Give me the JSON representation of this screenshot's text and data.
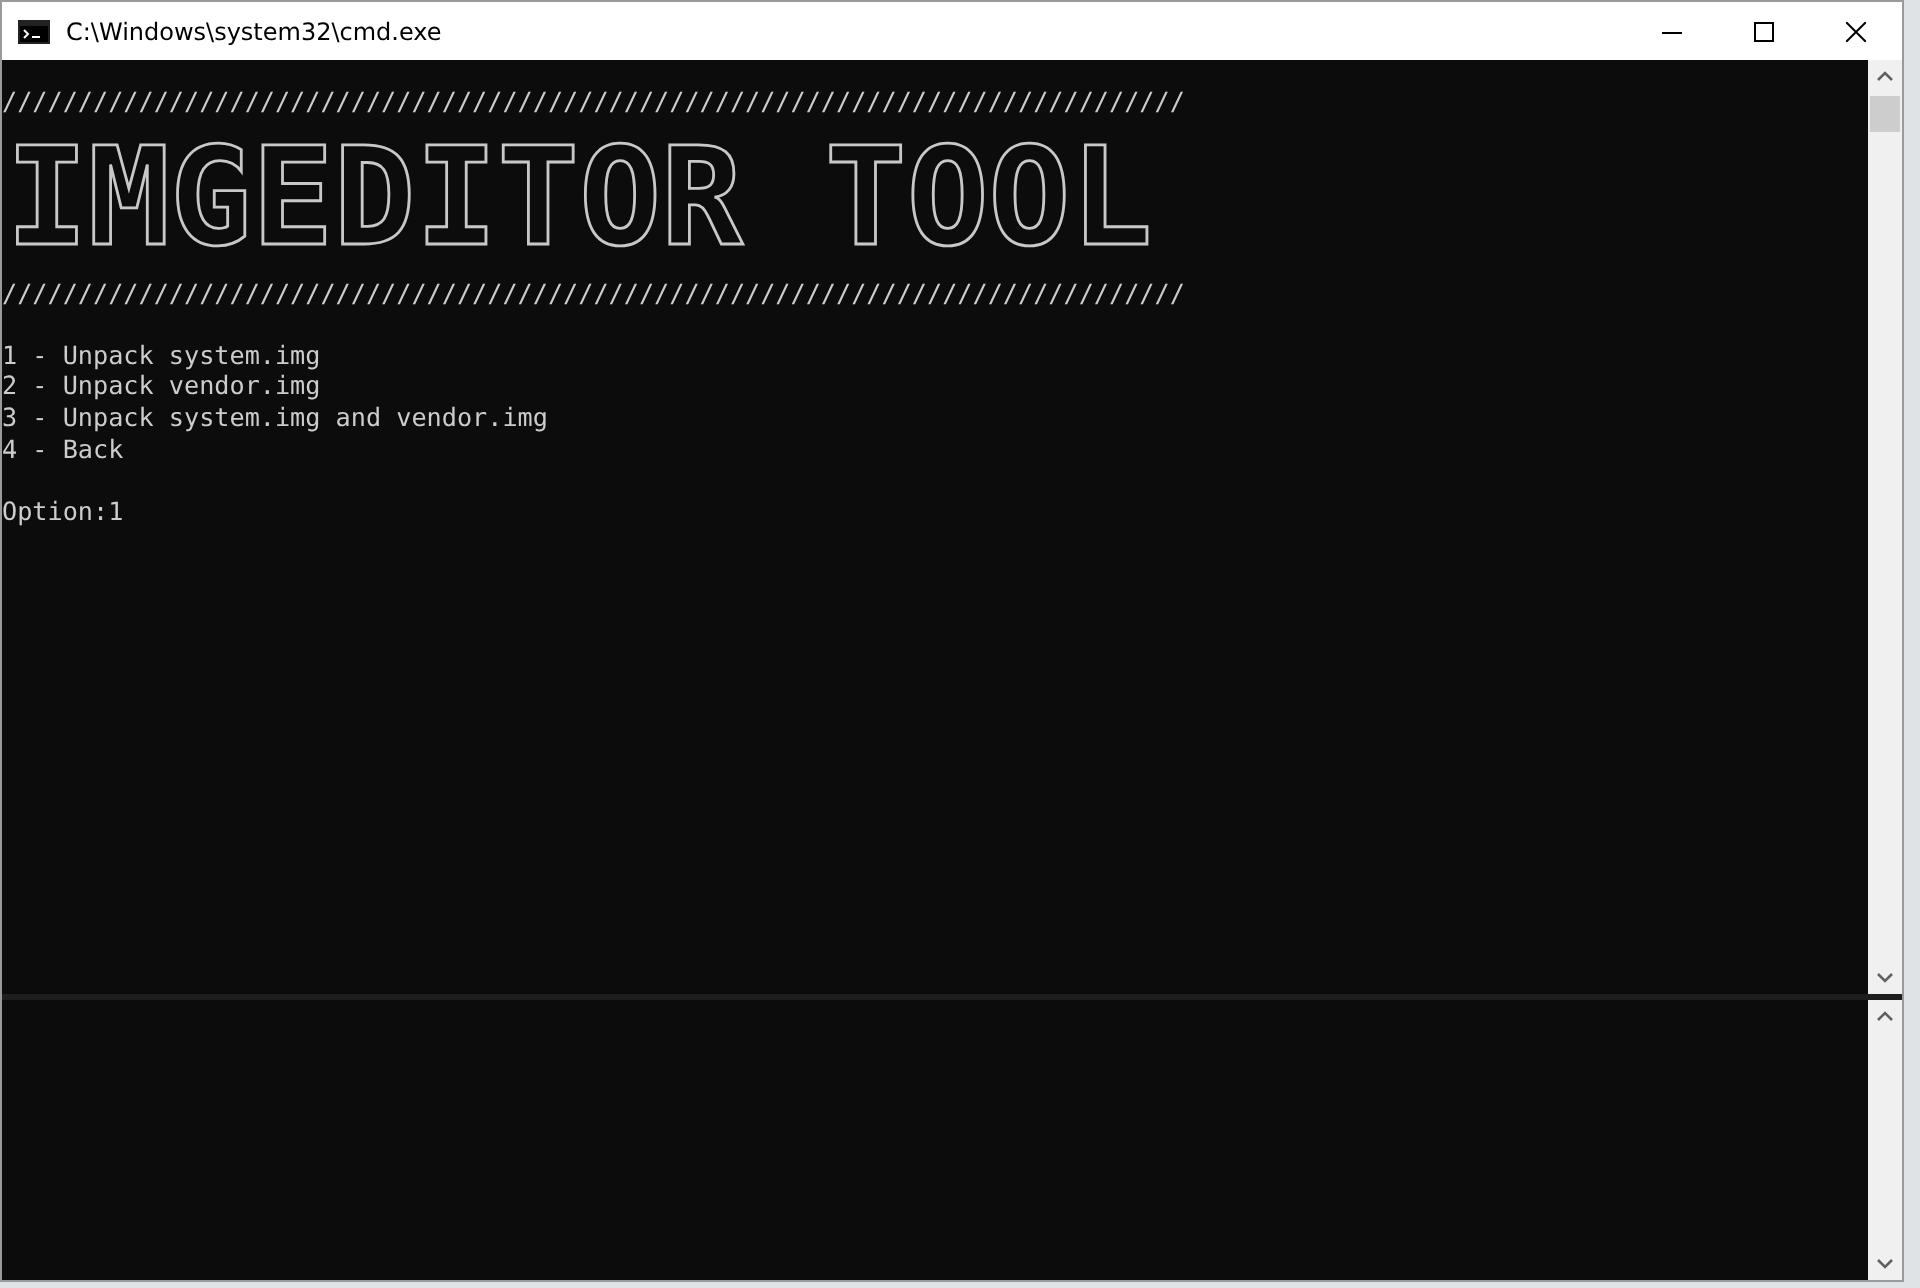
{
  "window": {
    "title": "C:\\Windows\\system32\\cmd.exe"
  },
  "console": {
    "rule_top": "//////////////////////////////////////////////////////////////////////////////",
    "banner": "IMGEDITOR TOOL",
    "rule_bottom": "//////////////////////////////////////////////////////////////////////////////",
    "lines": [
      "1 - Unpack system.img",
      "2 - Unpack vendor.img",
      "3 - Unpack system.img and vendor.img",
      "4 - Back",
      "Option:1"
    ]
  }
}
